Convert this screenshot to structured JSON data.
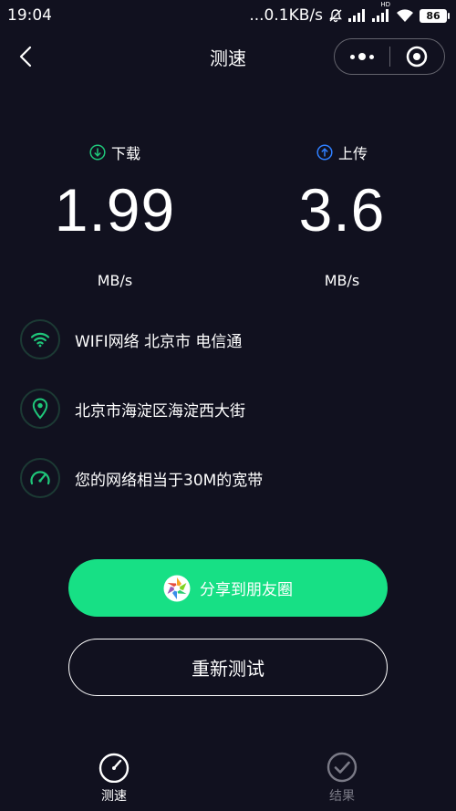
{
  "status_bar": {
    "time": "19:04",
    "network_speed": "...0.1KB/s",
    "hd_label": "HD",
    "battery": "86"
  },
  "nav": {
    "title": "测速"
  },
  "download": {
    "label": "下载",
    "value": "1.99",
    "unit": "MB/s"
  },
  "upload": {
    "label": "上传",
    "value": "3.6",
    "unit": "MB/s"
  },
  "info": {
    "network": "WIFI网络 北京市 电信通",
    "location": "北京市海淀区海淀西大街",
    "bandwidth": "您的网络相当于30M的宽带"
  },
  "actions": {
    "share_label": "分享到朋友圈",
    "retest_label": "重新测试"
  },
  "tabs": [
    {
      "label": "测速",
      "active": true
    },
    {
      "label": "结果",
      "active": false
    }
  ],
  "colors": {
    "background": "#11111f",
    "accent_green": "#17e085",
    "info_icon_green": "#1fc77a",
    "upload_blue": "#2f7fff",
    "inactive_tab": "#7a7a86"
  }
}
